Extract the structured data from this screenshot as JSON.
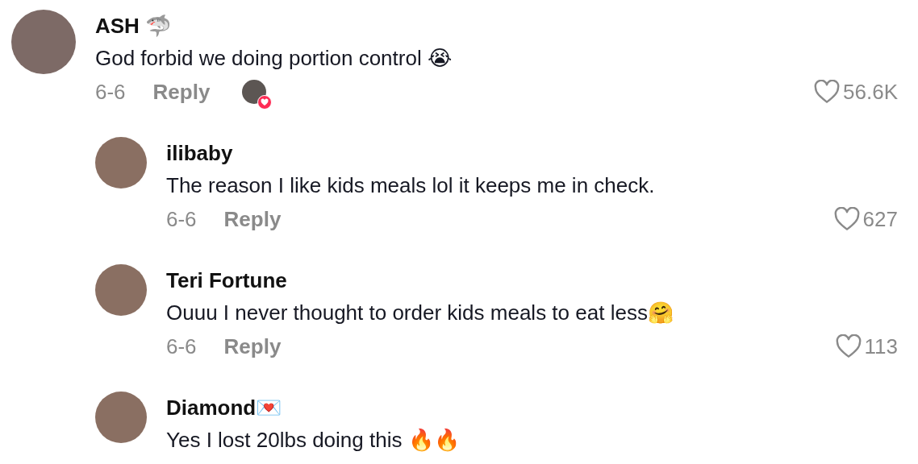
{
  "comments": [
    {
      "username": "ASH 🦈",
      "text": "God forbid we doing portion control 😭",
      "date": "6-6",
      "reply_label": "Reply",
      "liked_by_creator": true,
      "likes": "56.6K",
      "replies": [
        {
          "username": "ilibaby",
          "text": "The reason I like kids meals lol it keeps me in check.",
          "date": "6-6",
          "reply_label": "Reply",
          "liked_by_creator": false,
          "likes": "627"
        },
        {
          "username": "Teri Fortune",
          "text": "Ouuu I never thought to order kids meals to eat less🤗",
          "date": "6-6",
          "reply_label": "Reply",
          "liked_by_creator": false,
          "likes": "113"
        },
        {
          "username": "Diamond💌",
          "text": "Yes I lost 20lbs doing this 🔥🔥"
        }
      ]
    }
  ]
}
